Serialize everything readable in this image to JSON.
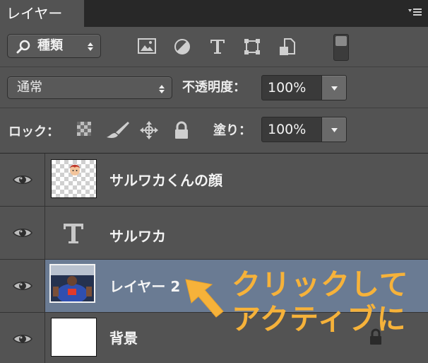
{
  "panel": {
    "tab_title": "レイヤー"
  },
  "filter": {
    "kind_label": "種類",
    "icons": [
      "image-filter-icon",
      "adjustment-filter-icon",
      "type-filter-icon",
      "shape-filter-icon",
      "smart-object-filter-icon"
    ]
  },
  "blend": {
    "mode": "通常",
    "opacity_label": "不透明度：",
    "opacity_value": "100%"
  },
  "lock": {
    "label": "ロック：",
    "icons": [
      "lock-transparent-pixels-icon",
      "lock-image-pixels-icon",
      "lock-position-icon",
      "lock-all-icon"
    ],
    "fill_label": "塗り：",
    "fill_value": "100%"
  },
  "layers": [
    {
      "name": "サルワカくんの顔",
      "thumbnail": "face-on-transparency",
      "visible": true,
      "selected": false
    },
    {
      "name": "サルワカ",
      "thumbnail": "type-layer",
      "visible": true,
      "selected": false
    },
    {
      "name": "レイヤー 2",
      "thumbnail": "photo",
      "visible": true,
      "selected": true
    },
    {
      "name": "背景",
      "thumbnail": "white",
      "visible": true,
      "selected": false,
      "locked": true
    }
  ],
  "annotation": {
    "line1": "クリックして",
    "line2": "アクティブに",
    "color": "#f6b23a"
  },
  "colors": {
    "panel_bg": "#535353",
    "selected_row": "#6a7b93",
    "tab_bar": "#282828"
  }
}
